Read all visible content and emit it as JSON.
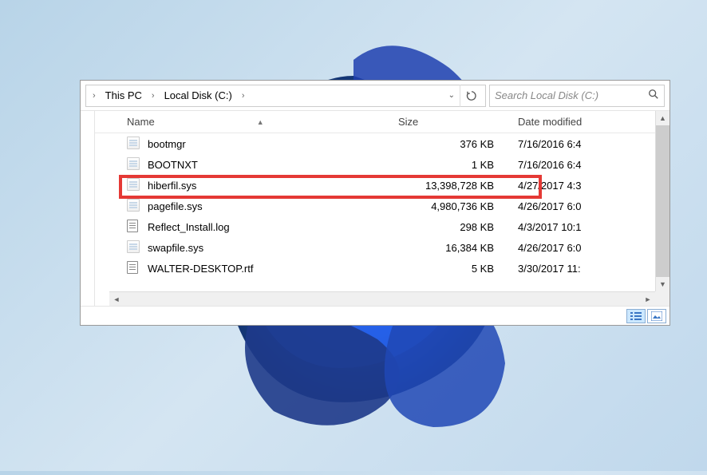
{
  "breadcrumb": {
    "items": [
      "This PC",
      "Local Disk (C:)"
    ]
  },
  "search": {
    "placeholder": "Search Local Disk (C:)"
  },
  "columns": {
    "name": "Name",
    "size": "Size",
    "date": "Date modified"
  },
  "files": [
    {
      "name": "bootmgr",
      "size": "376 KB",
      "date": "7/16/2016 6:4",
      "icon": "sys"
    },
    {
      "name": "BOOTNXT",
      "size": "1 KB",
      "date": "7/16/2016 6:4",
      "icon": "sys"
    },
    {
      "name": "hiberfil.sys",
      "size": "13,398,728 KB",
      "date": "4/27/2017 4:3",
      "icon": "sys",
      "highlighted": true
    },
    {
      "name": "pagefile.sys",
      "size": "4,980,736 KB",
      "date": "4/26/2017 6:0",
      "icon": "sys"
    },
    {
      "name": "Reflect_Install.log",
      "size": "298 KB",
      "date": "4/3/2017 10:1",
      "icon": "txt"
    },
    {
      "name": "swapfile.sys",
      "size": "16,384 KB",
      "date": "4/26/2017 6:0",
      "icon": "sys"
    },
    {
      "name": "WALTER-DESKTOP.rtf",
      "size": "5 KB",
      "date": "3/30/2017 11:",
      "icon": "txt"
    }
  ]
}
